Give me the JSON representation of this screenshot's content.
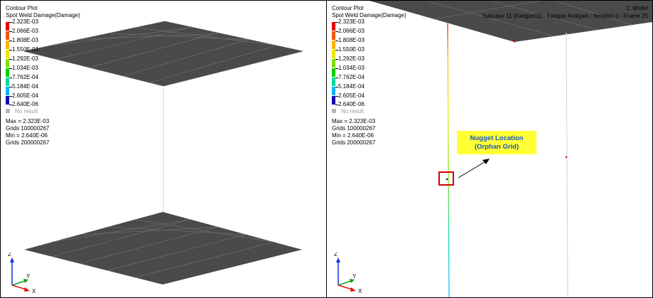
{
  "left_view": {
    "legend": {
      "title": "Contour Plot",
      "subtitle": "Spot Weld Damage(Damage)",
      "levels": [
        {
          "label": "2.323E-03",
          "color": "#e40000"
        },
        {
          "label": "2.066E-03",
          "color": "#f45a00"
        },
        {
          "label": "1.808E-03",
          "color": "#ffb300"
        },
        {
          "label": "1.550E-03",
          "color": "#e8e800"
        },
        {
          "label": "1.292E-03",
          "color": "#7fe000"
        },
        {
          "label": "1.034E-03",
          "color": "#00d000"
        },
        {
          "label": "7.762E-04",
          "color": "#00dca0"
        },
        {
          "label": "5.184E-04",
          "color": "#00b4ff"
        },
        {
          "label": "2.605E-04",
          "color": "#0050ff"
        },
        {
          "label": "2.640E-06",
          "color": "#1a00b4"
        }
      ],
      "no_result": "No result",
      "max_label": "Max = 2.323E-03",
      "max_grid": "Grids 100000267",
      "min_label": "Min = 2.640E-06",
      "min_grid": "Grids 200000267"
    },
    "triad": {
      "z": "Z",
      "y": "Y",
      "x": "X"
    }
  },
  "right_view": {
    "legend": {
      "title": "Contour Plot",
      "subtitle": "Spot Weld Damage(Damage)",
      "levels": [
        {
          "label": "2.323E-03",
          "color": "#e40000"
        },
        {
          "label": "2.066E-03",
          "color": "#f45a00"
        },
        {
          "label": "1.808E-03",
          "color": "#ffb300"
        },
        {
          "label": "1.550E-03",
          "color": "#e8e800"
        },
        {
          "label": "1.292E-03",
          "color": "#7fe000"
        },
        {
          "label": "1.034E-03",
          "color": "#00d000"
        },
        {
          "label": "7.762E-04",
          "color": "#00dca0"
        },
        {
          "label": "5.184E-04",
          "color": "#00b4ff"
        },
        {
          "label": "2.605E-04",
          "color": "#0050ff"
        },
        {
          "label": "2.640E-06",
          "color": "#1a00b4"
        }
      ],
      "no_result": "No result",
      "max_label": "Max = 2.323E-03",
      "max_grid": "Grids 100000267",
      "min_label": "Min = 2.640E-06",
      "min_grid": "Grids 200000267"
    },
    "model_label": "1: Model",
    "subcase_label": "Subcase 11 (Fatigue11) - Fatigue Analysis : Iteration 0 - Frame 25",
    "callout": {
      "line1": "Nugget Location",
      "line2": "(Orphan Grid)"
    },
    "triad": {
      "z": "Z",
      "y": "Y",
      "x": "X"
    }
  },
  "colors": {
    "plate": "#4a4a4a",
    "mesh_line": "#6e6e6e",
    "callout_bg": "#ffff33",
    "callout_text": "#1a56c8",
    "highlight": "#d40000"
  }
}
